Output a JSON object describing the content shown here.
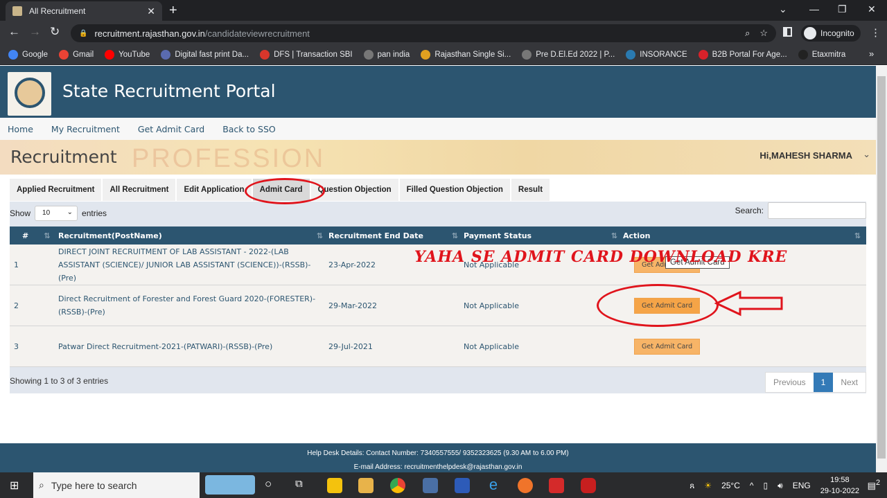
{
  "browser": {
    "tab_title": "All Recruitment",
    "url_host": "recruitment.rajasthan.gov.in",
    "url_path": "/candidateviewrecruitment",
    "profile": "Incognito",
    "bookmarks": [
      {
        "label": "Google",
        "color": "#4285f4"
      },
      {
        "label": "Gmail",
        "color": "#ea4335"
      },
      {
        "label": "YouTube",
        "color": "#ff0000"
      },
      {
        "label": "Digital fast print Da...",
        "color": "#5a6bb0"
      },
      {
        "label": "DFS | Transaction SBI",
        "color": "#d9362b"
      },
      {
        "label": "pan india",
        "color": "#777"
      },
      {
        "label": "Rajasthan Single Si...",
        "color": "#e0a020"
      },
      {
        "label": "Pre D.El.Ed 2022 | P...",
        "color": "#777"
      },
      {
        "label": "INSORANCE",
        "color": "#2a7ab0"
      },
      {
        "label": "B2B Portal For Age...",
        "color": "#d8222a"
      },
      {
        "label": "Etaxmitra",
        "color": "#222"
      }
    ]
  },
  "header": {
    "title": "State Recruitment Portal"
  },
  "nav": [
    "Home",
    "My Recruitment",
    "Get Admit Card",
    "Back to SSO"
  ],
  "banner": {
    "title": "Recruitment",
    "bg_text": "PROFESSION",
    "user": "Hi,MAHESH SHARMA"
  },
  "tabs": [
    {
      "label": "Applied Recruitment"
    },
    {
      "label": "All Recruitment"
    },
    {
      "label": "Edit Application"
    },
    {
      "label": "Admit Card",
      "active": true
    },
    {
      "label": "Question Objection"
    },
    {
      "label": "Filled Question Objection"
    },
    {
      "label": "Result"
    }
  ],
  "controls": {
    "show_label": "Show",
    "entries_value": "10",
    "entries_label": "entries",
    "search_label": "Search:"
  },
  "table": {
    "headers": [
      "#",
      "Recruitment(PostName)",
      "Recruitment End Date",
      "Payment Status",
      "Action"
    ],
    "rows": [
      {
        "num": "1",
        "post": "DIRECT JOINT RECRUITMENT OF LAB ASSISTANT - 2022-(LAB ASSISTANT (SCIENCE)/ JUNIOR LAB ASSISTANT (SCIENCE))-(RSSB)-(Pre)",
        "end_date": "23-Apr-2022",
        "payment": "Not Applicable",
        "action": "Get Admit Card"
      },
      {
        "num": "2",
        "post": "Direct Recruitment of Forester and Forest Guard 2020-(FORESTER)-(RSSB)-(Pre)",
        "end_date": "29-Mar-2022",
        "payment": "Not Applicable",
        "action": "Get Admit Card"
      },
      {
        "num": "3",
        "post": "Patwar Direct Recruitment-2021-(PATWARI)-(RSSB)-(Pre)",
        "end_date": "29-Jul-2021",
        "payment": "Not Applicable",
        "action": "Get Admit Card"
      }
    ]
  },
  "tooltip": "Get Admit Card",
  "info": "Showing 1 to 3 of 3 entries",
  "pager": {
    "prev": "Previous",
    "current": "1",
    "next": "Next"
  },
  "footer": {
    "helpdesk": "Help Desk Details: Contact Number: 7340557555/ 9352323625 (9.30 AM to 6.00 PM)",
    "email": "E-mail Address: recruitmenthelpdesk@rajasthan.gov.in"
  },
  "annotation": {
    "text": "YAHA SE ADMIT CARD DOWNLOAD KRE",
    "color": "#e0141c"
  },
  "taskbar": {
    "search_placeholder": "Type here to search",
    "temp": "25°C",
    "lang": "ENG",
    "time": "19:58",
    "date": "29-10-2022",
    "notifications": "2"
  }
}
